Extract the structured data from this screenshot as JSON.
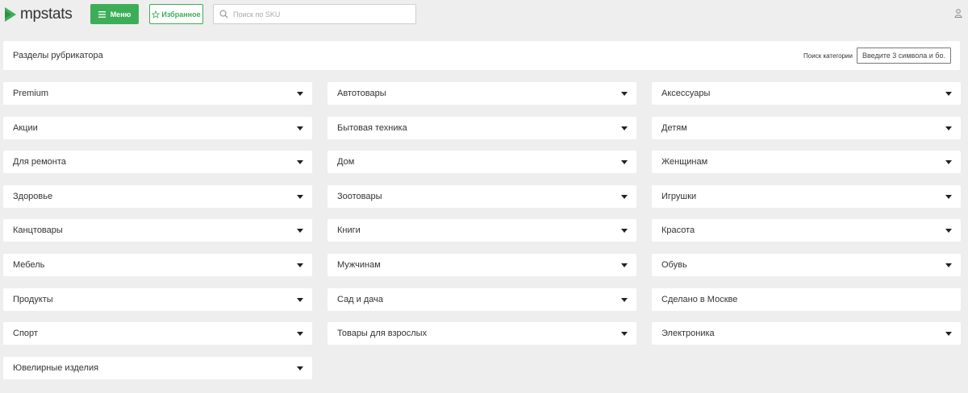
{
  "header": {
    "logo_text": "mpstats",
    "brand_color": "#3dae58",
    "menu_label": "Меню",
    "favorites_label": "Избранное",
    "search_placeholder": "Поиск по SKU"
  },
  "rubricator": {
    "title": "Разделы рубрикатора",
    "category_search_label": "Поиск категории",
    "category_search_placeholder": "Введите 3 символа и бо."
  },
  "categories": [
    {
      "label": "Premium",
      "has_dropdown": true
    },
    {
      "label": "Автотовары",
      "has_dropdown": true
    },
    {
      "label": "Аксессуары",
      "has_dropdown": true
    },
    {
      "label": "Акции",
      "has_dropdown": true
    },
    {
      "label": "Бытовая техника",
      "has_dropdown": true
    },
    {
      "label": "Детям",
      "has_dropdown": true
    },
    {
      "label": "Для ремонта",
      "has_dropdown": true
    },
    {
      "label": "Дом",
      "has_dropdown": true
    },
    {
      "label": "Женщинам",
      "has_dropdown": true
    },
    {
      "label": "Здоровье",
      "has_dropdown": true
    },
    {
      "label": "Зоотовары",
      "has_dropdown": true
    },
    {
      "label": "Игрушки",
      "has_dropdown": true
    },
    {
      "label": "Канцтовары",
      "has_dropdown": true
    },
    {
      "label": "Книги",
      "has_dropdown": true
    },
    {
      "label": "Красота",
      "has_dropdown": true
    },
    {
      "label": "Мебель",
      "has_dropdown": true
    },
    {
      "label": "Мужчинам",
      "has_dropdown": true
    },
    {
      "label": "Обувь",
      "has_dropdown": true
    },
    {
      "label": "Продукты",
      "has_dropdown": true
    },
    {
      "label": "Сад и дача",
      "has_dropdown": true
    },
    {
      "label": "Сделано в Москве",
      "has_dropdown": false
    },
    {
      "label": "Спорт",
      "has_dropdown": true
    },
    {
      "label": "Товары для взрослых",
      "has_dropdown": true
    },
    {
      "label": "Электроника",
      "has_dropdown": true
    },
    {
      "label": "Ювелирные изделия",
      "has_dropdown": true
    }
  ]
}
